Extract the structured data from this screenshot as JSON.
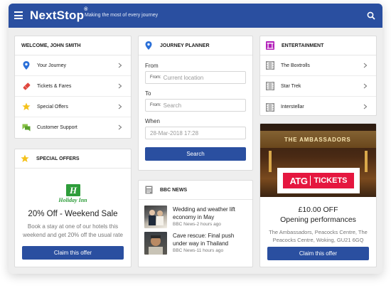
{
  "header": {
    "brand": "NextStop",
    "trademark": "®",
    "tagline": "Making the most of every journey",
    "menu_icon": "hamburger-icon",
    "search_icon": "search-icon",
    "color": "#2a4fa0"
  },
  "welcome": {
    "title": "WELCOME, JOHN SMITH",
    "items": [
      {
        "label": "Your Journey",
        "icon": "location-pin-icon"
      },
      {
        "label": "Tickets & Fares",
        "icon": "ticket-icon"
      },
      {
        "label": "Special Offers",
        "icon": "star-icon"
      },
      {
        "label": "Customer Support",
        "icon": "chat-bubble-icon"
      }
    ]
  },
  "special_offers": {
    "title": "SPECIAL OFFERS",
    "logo_text": "Holiday Inn",
    "offer_title": "20% Off - Weekend Sale",
    "description": "Book a stay at one of our hotels this weekend and get 20% off the usual rate",
    "button": "Claim this offer"
  },
  "journey": {
    "title": "JOURNEY PLANNER",
    "from_label": "From",
    "from_prefix": "From:",
    "from_value": "Current location",
    "to_label": "To",
    "to_prefix": "From:",
    "to_placeholder": "Search",
    "when_label": "When",
    "when_value": "28-Mar-2018 17:28",
    "search_button": "Search"
  },
  "news": {
    "title": "BBC NEWS",
    "items": [
      {
        "headline": "Wedding and weather lift economy in May",
        "meta": "BBC News-2 hours ago"
      },
      {
        "headline": "Cave rescue: Final push under way in Thailand",
        "meta": "BBC News-11 hours ago"
      }
    ]
  },
  "entertainment": {
    "title": "ENTERTAINMENT",
    "items": [
      {
        "label": "The Boxtrolls",
        "icon": "film-icon"
      },
      {
        "label": "Star Trek",
        "icon": "film-icon"
      },
      {
        "label": "Interstellar",
        "icon": "film-icon"
      }
    ],
    "theatre_sign": "THE AMBASSADORS",
    "banner_brand": "ATG",
    "banner_tickets": "TICKETS",
    "offer_title": "£10.00 OFF",
    "offer_subtitle": "Opening performances",
    "address": "The Ambassadors, Peacocks Centre, The Peacocks Centre, Woking, GU21 6GQ",
    "button": "Claim this offer"
  }
}
